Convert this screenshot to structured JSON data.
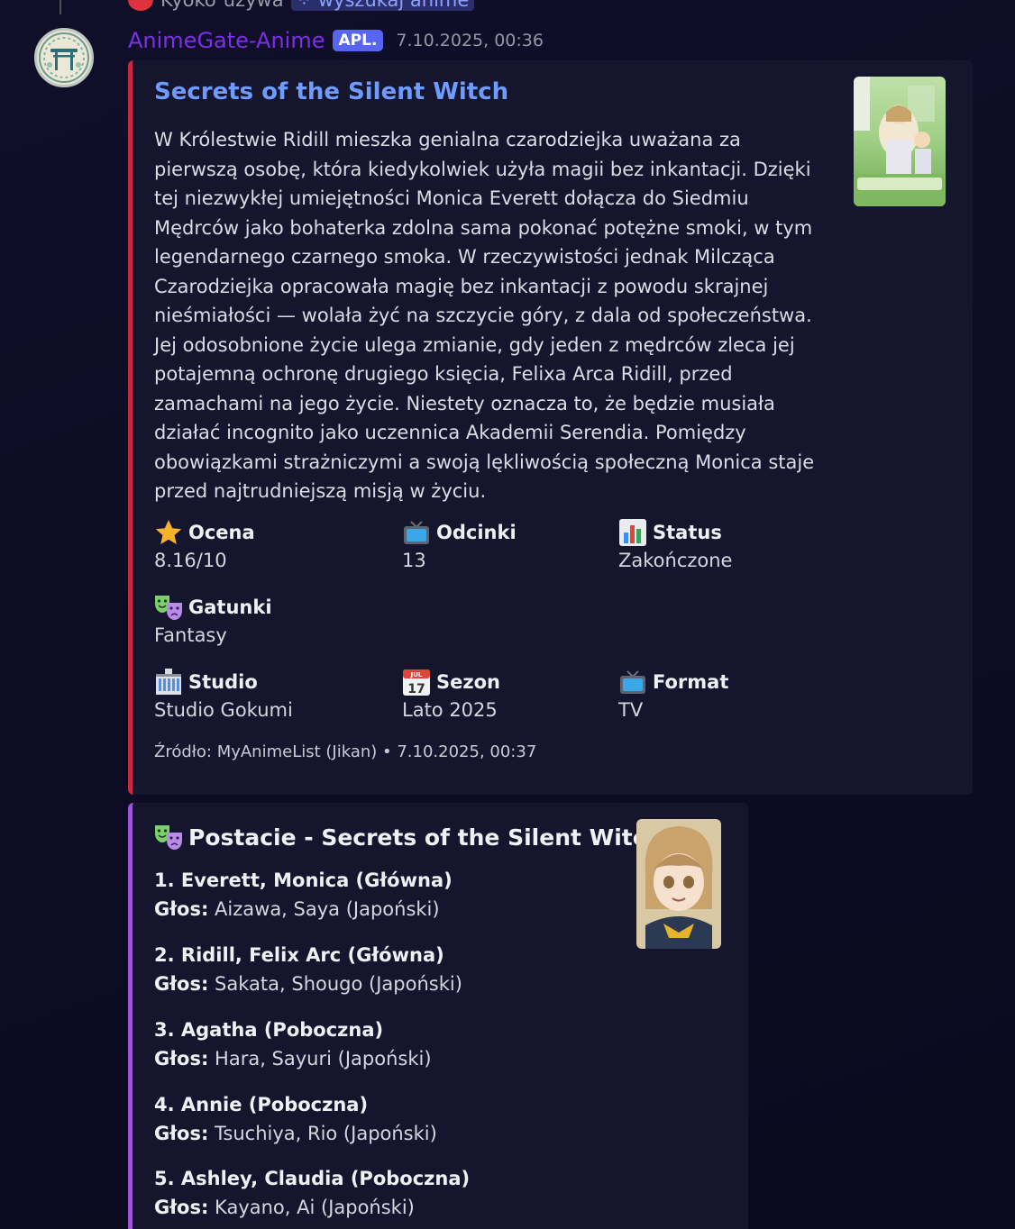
{
  "reply": {
    "user": "Kyoko",
    "verb": "używa",
    "command": "wyszukaj anime"
  },
  "header": {
    "username": "AnimeGate-Anime",
    "badge": "APL.",
    "timestamp": "7.10.2025, 00:36"
  },
  "embed": {
    "accent_color": "#c8293e",
    "title": "Secrets of the Silent Witch",
    "description": "W Królestwie Ridill mieszka genialna czarodziejka uważana za pierwszą osobę, która kiedykolwiek użyła magii bez inkantacji. Dzięki tej niezwykłej umiejętności Monica Everett dołącza do Siedmiu Mędrców jako bohaterka zdolna sama pokonać potężne smoki, w tym legendarnego czarnego smoka. W rzeczywistości jednak Milcząca Czarodziejka opracowała magię bez inkantacji z powodu skrajnej nieśmiałości — wolała żyć na szczycie góry, z dala od społeczeństwa. Jej odosobnione życie ulega zmianie, gdy jeden z mędrców zleca jej potajemną ochronę drugiego księcia, Felixa Arca Ridill, przed zamachami na jego życie. Niestety oznacza to, że będzie musiała działać incognito jako uczennica Akademii Serendia. Pomiędzy obowiązkami strażniczymi a swoją lękliwością społeczną Monica staje przed najtrudniejszą misją w życiu.",
    "fields": {
      "rating": {
        "icon": "star-icon",
        "name": "Ocena",
        "value": "8.16/10"
      },
      "episodes": {
        "icon": "tv-icon",
        "name": "Odcinki",
        "value": "13"
      },
      "status": {
        "icon": "bar-chart-icon",
        "name": "Status",
        "value": "Zakończone"
      },
      "genres": {
        "icon": "theater-masks-icon",
        "name": "Gatunki",
        "value": "Fantasy"
      },
      "studio": {
        "icon": "building-icon",
        "name": "Studio",
        "value": "Studio Gokumi"
      },
      "season": {
        "icon": "calendar-icon",
        "name": "Sezon",
        "value": "Lato 2025",
        "calendar_month": "JUL",
        "calendar_day": "17"
      },
      "format": {
        "icon": "tv-icon",
        "name": "Format",
        "value": "TV"
      }
    },
    "footer": "Źródło: MyAnimeList (Jikan) • 7.10.2025, 00:37"
  },
  "characters_embed": {
    "accent_color": "#9a56d6",
    "title": "Postacie - Secrets of the Silent Witch",
    "voice_label": "Głos:",
    "characters": [
      {
        "name": "1. Everett, Monica (Główna)",
        "voice": "Aizawa, Saya (Japoński)"
      },
      {
        "name": "2. Ridill, Felix Arc (Główna)",
        "voice": "Sakata, Shougo (Japoński)"
      },
      {
        "name": "3. Agatha (Poboczna)",
        "voice": "Hara, Sayuri (Japoński)"
      },
      {
        "name": "4. Annie (Poboczna)",
        "voice": "Tsuchiya, Rio (Japoński)"
      },
      {
        "name": "5. Ashley, Claudia (Poboczna)",
        "voice": "Kayano, Ai (Japoński)"
      }
    ]
  }
}
